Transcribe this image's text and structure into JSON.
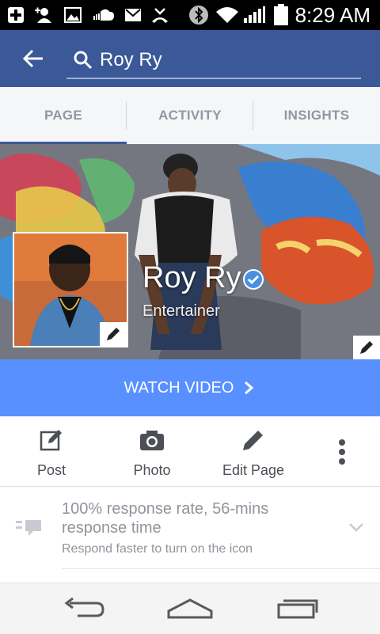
{
  "status_bar": {
    "time": "8:29 AM",
    "icons": [
      "plus-box-icon",
      "add-friend-icon",
      "image-icon",
      "soundcloud-icon",
      "gmail-icon",
      "missed-call-icon",
      "bluetooth-icon",
      "wifi-icon",
      "signal-icon",
      "battery-icon"
    ]
  },
  "header": {
    "search_query": "Roy Ry"
  },
  "tabs": [
    {
      "label": "PAGE",
      "active": true
    },
    {
      "label": "ACTIVITY",
      "active": false
    },
    {
      "label": "INSIGHTS",
      "active": false
    }
  ],
  "profile": {
    "name": "Roy Ry",
    "category": "Entertainer",
    "verified": true
  },
  "cta": {
    "label": "WATCH VIDEO"
  },
  "actions": [
    {
      "label": "Post",
      "icon": "compose-icon"
    },
    {
      "label": "Photo",
      "icon": "camera-icon"
    },
    {
      "label": "Edit Page",
      "icon": "pencil-icon"
    }
  ],
  "response": {
    "title": "100% response rate, 56-mins response time",
    "subtitle": "Respond faster to turn on the icon"
  },
  "colors": {
    "brand": "#3b5998",
    "cta": "#5890ff",
    "tab_text": "#9197a3"
  }
}
